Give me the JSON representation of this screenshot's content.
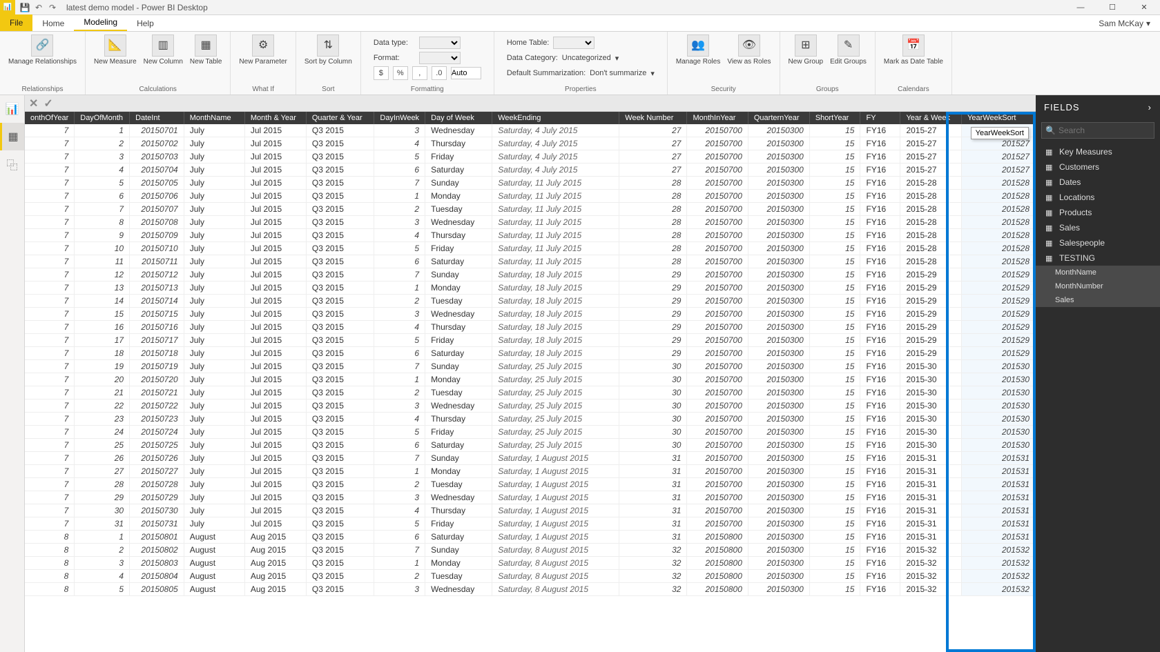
{
  "title": "latest demo model - Power BI Desktop",
  "user": "Sam McKay",
  "tabs": {
    "file": "File",
    "home": "Home",
    "modeling": "Modeling",
    "help": "Help"
  },
  "ribbon": {
    "relationships": {
      "btn": "Manage\nRelationships",
      "group": "Relationships"
    },
    "calc": {
      "btns": [
        "New\nMeasure",
        "New\nColumn",
        "New\nTable"
      ],
      "group": "Calculations"
    },
    "whatif": {
      "btn": "New\nParameter",
      "group": "What If"
    },
    "sort": {
      "btn": "Sort by\nColumn",
      "group": "Sort"
    },
    "fmt": {
      "dtype": "Data type:",
      "format": "Format:",
      "auto": "Auto",
      "group": "Formatting"
    },
    "props": {
      "home": "Home Table:",
      "cat": "Data Category:",
      "catval": "Uncategorized",
      "sum": "Default Summarization:",
      "sumval": "Don't summarize",
      "group": "Properties"
    },
    "sec": {
      "btns": [
        "Manage\nRoles",
        "View as\nRoles"
      ],
      "group": "Security"
    },
    "grp": {
      "btns": [
        "New\nGroup",
        "Edit\nGroups"
      ],
      "group": "Groups"
    },
    "cal": {
      "btn": "Mark as\nDate Table",
      "group": "Calendars"
    }
  },
  "tooltip": "YearWeekSort",
  "columns": [
    "onthOfYear",
    "DayOfMonth",
    "DateInt",
    "MonthName",
    "Month & Year",
    "Quarter & Year",
    "DayInWeek",
    "Day of Week",
    "WeekEnding",
    "Week Number",
    "MonthInYear",
    "QuarternYear",
    "ShortYear",
    "FY",
    "Year & Week",
    "YearWeekSort"
  ],
  "rows": [
    [
      "7",
      "1",
      "20150701",
      "July",
      "Jul 2015",
      "Q3 2015",
      "3",
      "Wednesday",
      "Saturday, 4 July 2015",
      "27",
      "20150700",
      "20150300",
      "15",
      "FY16",
      "2015-27",
      ""
    ],
    [
      "7",
      "2",
      "20150702",
      "July",
      "Jul 2015",
      "Q3 2015",
      "4",
      "Thursday",
      "Saturday, 4 July 2015",
      "27",
      "20150700",
      "20150300",
      "15",
      "FY16",
      "2015-27",
      "201527"
    ],
    [
      "7",
      "3",
      "20150703",
      "July",
      "Jul 2015",
      "Q3 2015",
      "5",
      "Friday",
      "Saturday, 4 July 2015",
      "27",
      "20150700",
      "20150300",
      "15",
      "FY16",
      "2015-27",
      "201527"
    ],
    [
      "7",
      "4",
      "20150704",
      "July",
      "Jul 2015",
      "Q3 2015",
      "6",
      "Saturday",
      "Saturday, 4 July 2015",
      "27",
      "20150700",
      "20150300",
      "15",
      "FY16",
      "2015-27",
      "201527"
    ],
    [
      "7",
      "5",
      "20150705",
      "July",
      "Jul 2015",
      "Q3 2015",
      "7",
      "Sunday",
      "Saturday, 11 July 2015",
      "28",
      "20150700",
      "20150300",
      "15",
      "FY16",
      "2015-28",
      "201528"
    ],
    [
      "7",
      "6",
      "20150706",
      "July",
      "Jul 2015",
      "Q3 2015",
      "1",
      "Monday",
      "Saturday, 11 July 2015",
      "28",
      "20150700",
      "20150300",
      "15",
      "FY16",
      "2015-28",
      "201528"
    ],
    [
      "7",
      "7",
      "20150707",
      "July",
      "Jul 2015",
      "Q3 2015",
      "2",
      "Tuesday",
      "Saturday, 11 July 2015",
      "28",
      "20150700",
      "20150300",
      "15",
      "FY16",
      "2015-28",
      "201528"
    ],
    [
      "7",
      "8",
      "20150708",
      "July",
      "Jul 2015",
      "Q3 2015",
      "3",
      "Wednesday",
      "Saturday, 11 July 2015",
      "28",
      "20150700",
      "20150300",
      "15",
      "FY16",
      "2015-28",
      "201528"
    ],
    [
      "7",
      "9",
      "20150709",
      "July",
      "Jul 2015",
      "Q3 2015",
      "4",
      "Thursday",
      "Saturday, 11 July 2015",
      "28",
      "20150700",
      "20150300",
      "15",
      "FY16",
      "2015-28",
      "201528"
    ],
    [
      "7",
      "10",
      "20150710",
      "July",
      "Jul 2015",
      "Q3 2015",
      "5",
      "Friday",
      "Saturday, 11 July 2015",
      "28",
      "20150700",
      "20150300",
      "15",
      "FY16",
      "2015-28",
      "201528"
    ],
    [
      "7",
      "11",
      "20150711",
      "July",
      "Jul 2015",
      "Q3 2015",
      "6",
      "Saturday",
      "Saturday, 11 July 2015",
      "28",
      "20150700",
      "20150300",
      "15",
      "FY16",
      "2015-28",
      "201528"
    ],
    [
      "7",
      "12",
      "20150712",
      "July",
      "Jul 2015",
      "Q3 2015",
      "7",
      "Sunday",
      "Saturday, 18 July 2015",
      "29",
      "20150700",
      "20150300",
      "15",
      "FY16",
      "2015-29",
      "201529"
    ],
    [
      "7",
      "13",
      "20150713",
      "July",
      "Jul 2015",
      "Q3 2015",
      "1",
      "Monday",
      "Saturday, 18 July 2015",
      "29",
      "20150700",
      "20150300",
      "15",
      "FY16",
      "2015-29",
      "201529"
    ],
    [
      "7",
      "14",
      "20150714",
      "July",
      "Jul 2015",
      "Q3 2015",
      "2",
      "Tuesday",
      "Saturday, 18 July 2015",
      "29",
      "20150700",
      "20150300",
      "15",
      "FY16",
      "2015-29",
      "201529"
    ],
    [
      "7",
      "15",
      "20150715",
      "July",
      "Jul 2015",
      "Q3 2015",
      "3",
      "Wednesday",
      "Saturday, 18 July 2015",
      "29",
      "20150700",
      "20150300",
      "15",
      "FY16",
      "2015-29",
      "201529"
    ],
    [
      "7",
      "16",
      "20150716",
      "July",
      "Jul 2015",
      "Q3 2015",
      "4",
      "Thursday",
      "Saturday, 18 July 2015",
      "29",
      "20150700",
      "20150300",
      "15",
      "FY16",
      "2015-29",
      "201529"
    ],
    [
      "7",
      "17",
      "20150717",
      "July",
      "Jul 2015",
      "Q3 2015",
      "5",
      "Friday",
      "Saturday, 18 July 2015",
      "29",
      "20150700",
      "20150300",
      "15",
      "FY16",
      "2015-29",
      "201529"
    ],
    [
      "7",
      "18",
      "20150718",
      "July",
      "Jul 2015",
      "Q3 2015",
      "6",
      "Saturday",
      "Saturday, 18 July 2015",
      "29",
      "20150700",
      "20150300",
      "15",
      "FY16",
      "2015-29",
      "201529"
    ],
    [
      "7",
      "19",
      "20150719",
      "July",
      "Jul 2015",
      "Q3 2015",
      "7",
      "Sunday",
      "Saturday, 25 July 2015",
      "30",
      "20150700",
      "20150300",
      "15",
      "FY16",
      "2015-30",
      "201530"
    ],
    [
      "7",
      "20",
      "20150720",
      "July",
      "Jul 2015",
      "Q3 2015",
      "1",
      "Monday",
      "Saturday, 25 July 2015",
      "30",
      "20150700",
      "20150300",
      "15",
      "FY16",
      "2015-30",
      "201530"
    ],
    [
      "7",
      "21",
      "20150721",
      "July",
      "Jul 2015",
      "Q3 2015",
      "2",
      "Tuesday",
      "Saturday, 25 July 2015",
      "30",
      "20150700",
      "20150300",
      "15",
      "FY16",
      "2015-30",
      "201530"
    ],
    [
      "7",
      "22",
      "20150722",
      "July",
      "Jul 2015",
      "Q3 2015",
      "3",
      "Wednesday",
      "Saturday, 25 July 2015",
      "30",
      "20150700",
      "20150300",
      "15",
      "FY16",
      "2015-30",
      "201530"
    ],
    [
      "7",
      "23",
      "20150723",
      "July",
      "Jul 2015",
      "Q3 2015",
      "4",
      "Thursday",
      "Saturday, 25 July 2015",
      "30",
      "20150700",
      "20150300",
      "15",
      "FY16",
      "2015-30",
      "201530"
    ],
    [
      "7",
      "24",
      "20150724",
      "July",
      "Jul 2015",
      "Q3 2015",
      "5",
      "Friday",
      "Saturday, 25 July 2015",
      "30",
      "20150700",
      "20150300",
      "15",
      "FY16",
      "2015-30",
      "201530"
    ],
    [
      "7",
      "25",
      "20150725",
      "July",
      "Jul 2015",
      "Q3 2015",
      "6",
      "Saturday",
      "Saturday, 25 July 2015",
      "30",
      "20150700",
      "20150300",
      "15",
      "FY16",
      "2015-30",
      "201530"
    ],
    [
      "7",
      "26",
      "20150726",
      "July",
      "Jul 2015",
      "Q3 2015",
      "7",
      "Sunday",
      "Saturday, 1 August 2015",
      "31",
      "20150700",
      "20150300",
      "15",
      "FY16",
      "2015-31",
      "201531"
    ],
    [
      "7",
      "27",
      "20150727",
      "July",
      "Jul 2015",
      "Q3 2015",
      "1",
      "Monday",
      "Saturday, 1 August 2015",
      "31",
      "20150700",
      "20150300",
      "15",
      "FY16",
      "2015-31",
      "201531"
    ],
    [
      "7",
      "28",
      "20150728",
      "July",
      "Jul 2015",
      "Q3 2015",
      "2",
      "Tuesday",
      "Saturday, 1 August 2015",
      "31",
      "20150700",
      "20150300",
      "15",
      "FY16",
      "2015-31",
      "201531"
    ],
    [
      "7",
      "29",
      "20150729",
      "July",
      "Jul 2015",
      "Q3 2015",
      "3",
      "Wednesday",
      "Saturday, 1 August 2015",
      "31",
      "20150700",
      "20150300",
      "15",
      "FY16",
      "2015-31",
      "201531"
    ],
    [
      "7",
      "30",
      "20150730",
      "July",
      "Jul 2015",
      "Q3 2015",
      "4",
      "Thursday",
      "Saturday, 1 August 2015",
      "31",
      "20150700",
      "20150300",
      "15",
      "FY16",
      "2015-31",
      "201531"
    ],
    [
      "7",
      "31",
      "20150731",
      "July",
      "Jul 2015",
      "Q3 2015",
      "5",
      "Friday",
      "Saturday, 1 August 2015",
      "31",
      "20150700",
      "20150300",
      "15",
      "FY16",
      "2015-31",
      "201531"
    ],
    [
      "8",
      "1",
      "20150801",
      "August",
      "Aug 2015",
      "Q3 2015",
      "6",
      "Saturday",
      "Saturday, 1 August 2015",
      "31",
      "20150800",
      "20150300",
      "15",
      "FY16",
      "2015-31",
      "201531"
    ],
    [
      "8",
      "2",
      "20150802",
      "August",
      "Aug 2015",
      "Q3 2015",
      "7",
      "Sunday",
      "Saturday, 8 August 2015",
      "32",
      "20150800",
      "20150300",
      "15",
      "FY16",
      "2015-32",
      "201532"
    ],
    [
      "8",
      "3",
      "20150803",
      "August",
      "Aug 2015",
      "Q3 2015",
      "1",
      "Monday",
      "Saturday, 8 August 2015",
      "32",
      "20150800",
      "20150300",
      "15",
      "FY16",
      "2015-32",
      "201532"
    ],
    [
      "8",
      "4",
      "20150804",
      "August",
      "Aug 2015",
      "Q3 2015",
      "2",
      "Tuesday",
      "Saturday, 8 August 2015",
      "32",
      "20150800",
      "20150300",
      "15",
      "FY16",
      "2015-32",
      "201532"
    ],
    [
      "8",
      "5",
      "20150805",
      "August",
      "Aug 2015",
      "Q3 2015",
      "3",
      "Wednesday",
      "Saturday, 8 August 2015",
      "32",
      "20150800",
      "20150300",
      "15",
      "FY16",
      "2015-32",
      "201532"
    ]
  ],
  "fields": {
    "header": "FIELDS",
    "search": "Search",
    "tables": [
      "Key Measures",
      "Customers",
      "Dates",
      "Locations",
      "Products",
      "Sales",
      "Salespeople",
      "TESTING"
    ],
    "selected": [
      "MonthName",
      "MonthNumber",
      "Sales"
    ]
  }
}
